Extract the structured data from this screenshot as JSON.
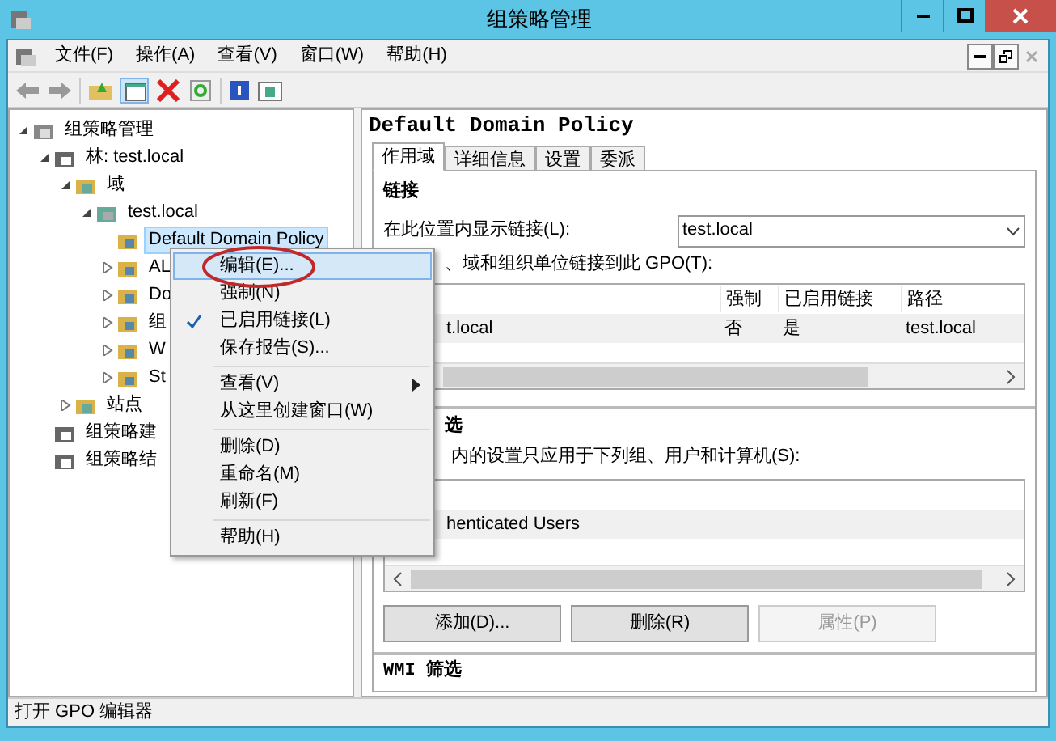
{
  "window": {
    "title": "组策略管理"
  },
  "menu_bar": [
    "文件(F)",
    "操作(A)",
    "查看(V)",
    "窗口(W)",
    "帮助(H)"
  ],
  "mdi_buttons": [
    {
      "kind": "minimize",
      "disabled": false
    },
    {
      "kind": "restore",
      "disabled": false
    },
    {
      "kind": "close",
      "disabled": true
    }
  ],
  "tree": [
    {
      "label": "组策略管理",
      "expanded": true,
      "selected": false,
      "children": [
        {
          "label": "林: test.local",
          "expanded": true,
          "selected": false,
          "children": [
            {
              "label": "域",
              "expanded": true,
              "selected": false,
              "children": [
                {
                  "label": "test.local",
                  "expanded": true,
                  "selected": false,
                  "children": [
                    {
                      "label": "Default Domain Policy",
                      "selected": true
                    },
                    {
                      "label": "AL",
                      "expanded": false,
                      "selected": false
                    },
                    {
                      "label": "Do",
                      "expanded": false,
                      "selected": false
                    },
                    {
                      "label": "组",
                      "expanded": false,
                      "selected": false
                    },
                    {
                      "label": "W",
                      "expanded": false,
                      "selected": false
                    },
                    {
                      "label": "St",
                      "expanded": false,
                      "selected": false
                    }
                  ]
                }
              ]
            },
            {
              "label": "站点",
              "expanded": false,
              "selected": false
            }
          ]
        },
        {
          "label": "组策略建",
          "selected": false
        },
        {
          "label": "组策略结",
          "selected": false
        }
      ]
    }
  ],
  "context_menu": [
    {
      "kind": "item",
      "label": "编辑(E)...",
      "selected": true,
      "checked": false,
      "submenu": false
    },
    {
      "kind": "item",
      "label": "强制(N)",
      "selected": false,
      "checked": false,
      "submenu": false
    },
    {
      "kind": "item",
      "label": "已启用链接(L)",
      "selected": false,
      "checked": true,
      "submenu": false
    },
    {
      "kind": "item",
      "label": "保存报告(S)...",
      "selected": false,
      "checked": false,
      "submenu": false
    },
    {
      "kind": "separator"
    },
    {
      "kind": "item",
      "label": "查看(V)",
      "selected": false,
      "checked": false,
      "submenu": true
    },
    {
      "kind": "item",
      "label": "从这里创建窗口(W)",
      "selected": false,
      "checked": false,
      "submenu": false
    },
    {
      "kind": "separator"
    },
    {
      "kind": "item",
      "label": "删除(D)",
      "selected": false,
      "checked": false,
      "submenu": false
    },
    {
      "kind": "item",
      "label": "重命名(M)",
      "selected": false,
      "checked": false,
      "submenu": false
    },
    {
      "kind": "item",
      "label": "刷新(F)",
      "selected": false,
      "checked": false,
      "submenu": false
    },
    {
      "kind": "separator"
    },
    {
      "kind": "item",
      "label": "帮助(H)",
      "selected": false,
      "checked": false,
      "submenu": false
    }
  ],
  "details": {
    "title": "Default Domain Policy",
    "tabs": [
      {
        "label": "作用域",
        "selected": true
      },
      {
        "label": "详细信息",
        "selected": false
      },
      {
        "label": "设置",
        "selected": false
      },
      {
        "label": "委派",
        "selected": false
      }
    ],
    "links": {
      "heading": "链接",
      "location_label": "在此位置内显示链接(L):",
      "location_value": "test.local",
      "list_label": "、域和组织单位链接到此 GPO(T):",
      "columns": [
        "",
        "强制",
        "已启用链接",
        "路径"
      ],
      "rows": [
        {
          "cells": [
            "t.local",
            "否",
            "是",
            "test.local"
          ],
          "selected": true
        }
      ]
    },
    "security_filter": {
      "heading": "选",
      "description": "内的设置只应用于下列组、用户和计算机(S):",
      "rows": [
        {
          "label": "henticated Users",
          "selected": true
        }
      ],
      "buttons": [
        {
          "label": "添加(D)...",
          "disabled": false
        },
        {
          "label": "删除(R)",
          "disabled": false
        },
        {
          "label": "属性(P)",
          "disabled": true
        }
      ]
    },
    "wmi_heading": "WMI 筛选"
  },
  "status_bar": "打开 GPO 编辑器"
}
